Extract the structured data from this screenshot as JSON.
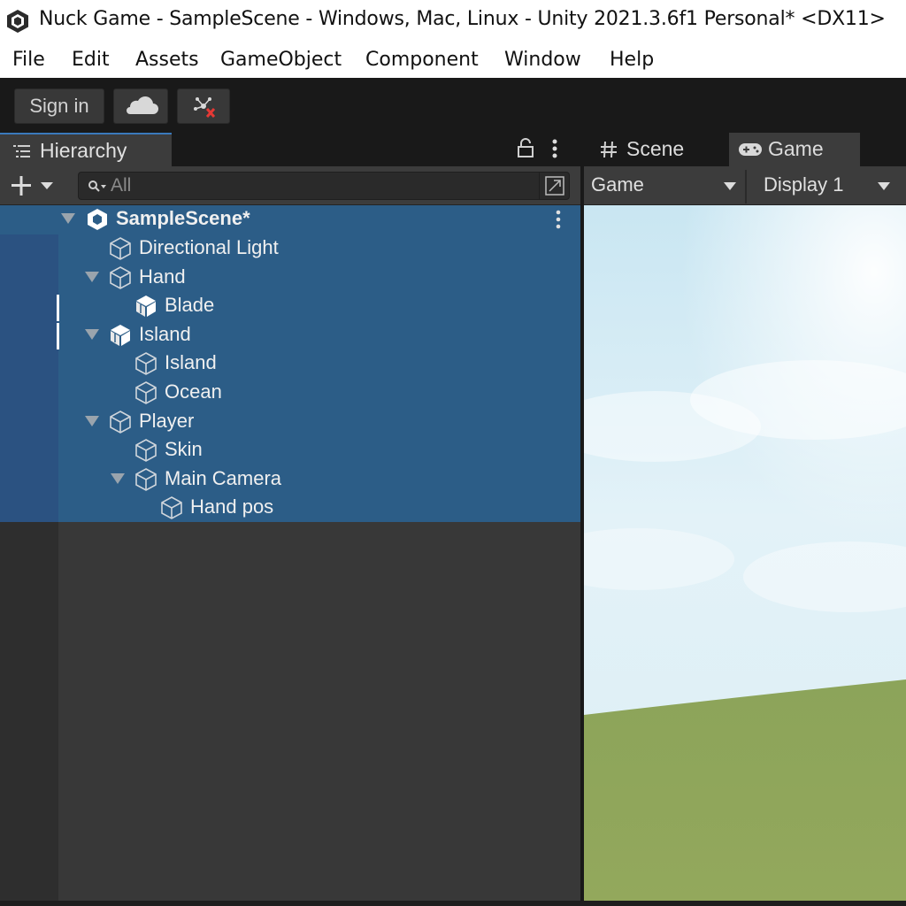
{
  "window": {
    "title": "Nuck Game - SampleScene - Windows, Mac, Linux - Unity 2021.3.6f1 Personal* <DX11>",
    "icon": "unity-logo-icon"
  },
  "menu": [
    "File",
    "Edit",
    "Assets",
    "GameObject",
    "Component",
    "Window",
    "Help"
  ],
  "toolbar": {
    "sign_in_label": "Sign in",
    "cloud_icon": "cloud-icon",
    "collab_icon": "collab-error-icon"
  },
  "hierarchy": {
    "tab_label": "Hierarchy",
    "search_placeholder": "All",
    "scene": "SampleScene*",
    "items": [
      {
        "name": "Directional Light",
        "depth": 1,
        "expanded": null,
        "icon": "gameobject-icon"
      },
      {
        "name": "Hand",
        "depth": 1,
        "expanded": true,
        "icon": "gameobject-icon"
      },
      {
        "name": "Blade",
        "depth": 2,
        "expanded": null,
        "icon": "prefab-icon"
      },
      {
        "name": "Island",
        "depth": 1,
        "expanded": true,
        "icon": "prefab-icon"
      },
      {
        "name": "Island",
        "depth": 2,
        "expanded": null,
        "icon": "gameobject-icon"
      },
      {
        "name": "Ocean",
        "depth": 2,
        "expanded": null,
        "icon": "gameobject-icon"
      },
      {
        "name": "Player",
        "depth": 1,
        "expanded": true,
        "icon": "gameobject-icon"
      },
      {
        "name": "Skin",
        "depth": 2,
        "expanded": null,
        "icon": "gameobject-icon"
      },
      {
        "name": "Main Camera",
        "depth": 2,
        "expanded": true,
        "icon": "gameobject-icon"
      },
      {
        "name": "Hand pos",
        "depth": 3,
        "expanded": null,
        "icon": "gameobject-icon"
      }
    ]
  },
  "view_tabs": {
    "scene_label": "Scene",
    "game_label": "Game"
  },
  "game_toolbar": {
    "view_mode": "Game",
    "display": "Display 1"
  },
  "colors": {
    "selection": "#2c5d87",
    "panel": "#383838",
    "accent": "#3a79bb"
  }
}
